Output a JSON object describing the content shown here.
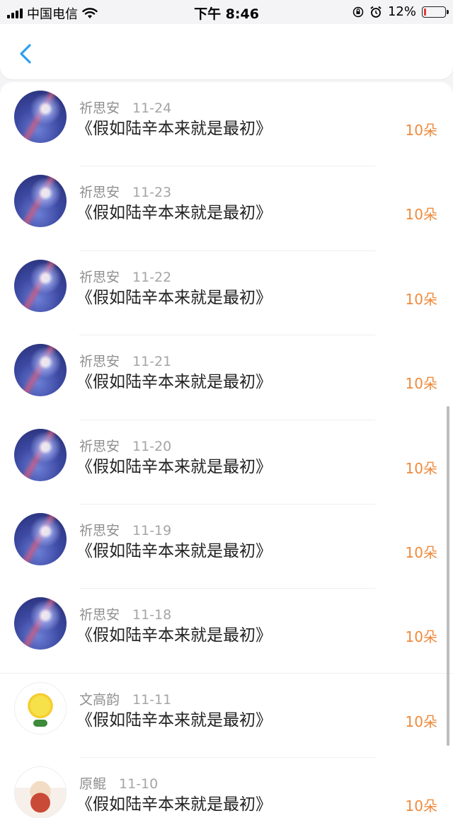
{
  "status_bar": {
    "carrier": "中国电信",
    "time": "下午 8:46",
    "battery_percent": "12%",
    "battery_level": 0.12
  },
  "nav": {
    "back_icon": "chevron-left-icon"
  },
  "colors": {
    "accent": "#2e9df0",
    "amount": "#ef8a3c"
  },
  "rows": [
    {
      "name": "祈思安",
      "date": "11-24",
      "title": "《假如陆辛本来就是最初》",
      "amount": "10朵",
      "avatar": "galaxy"
    },
    {
      "name": "祈思安",
      "date": "11-23",
      "title": "《假如陆辛本来就是最初》",
      "amount": "10朵",
      "avatar": "galaxy"
    },
    {
      "name": "祈思安",
      "date": "11-22",
      "title": "《假如陆辛本来就是最初》",
      "amount": "10朵",
      "avatar": "galaxy"
    },
    {
      "name": "祈思安",
      "date": "11-21",
      "title": "《假如陆辛本来就是最初》",
      "amount": "10朵",
      "avatar": "galaxy"
    },
    {
      "name": "祈思安",
      "date": "11-20",
      "title": "《假如陆辛本来就是最初》",
      "amount": "10朵",
      "avatar": "galaxy"
    },
    {
      "name": "祈思安",
      "date": "11-19",
      "title": "《假如陆辛本来就是最初》",
      "amount": "10朵",
      "avatar": "galaxy"
    },
    {
      "name": "祈思安",
      "date": "11-18",
      "title": "《假如陆辛本来就是最初》",
      "amount": "10朵",
      "avatar": "galaxy"
    },
    {
      "name": "文高韵",
      "date": "11-11",
      "title": "《假如陆辛本来就是最初》",
      "amount": "10朵",
      "avatar": "pikachu"
    },
    {
      "name": "原鲲",
      "date": "11-10",
      "title": "《假如陆辛本来就是最初》",
      "amount": "10朵",
      "avatar": "chef"
    }
  ]
}
